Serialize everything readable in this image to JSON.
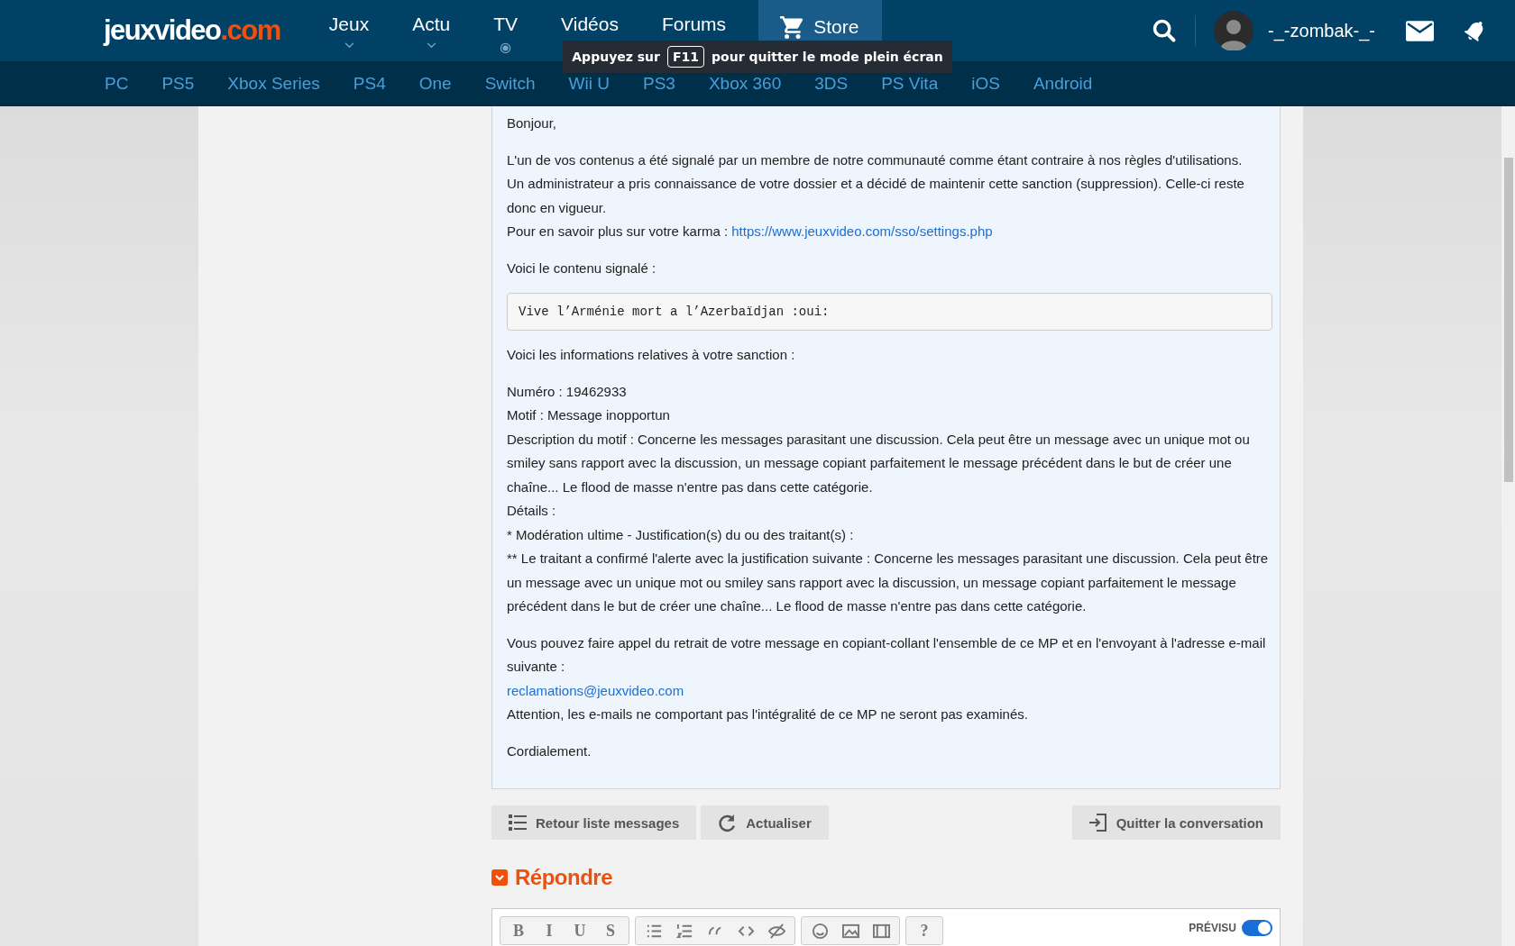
{
  "header": {
    "logo": {
      "main": "jeuxvideo",
      "accent": ".com"
    },
    "nav": [
      {
        "label": "Jeux",
        "selected": false
      },
      {
        "label": "Actu",
        "selected": false
      },
      {
        "label": "TV",
        "selected": false
      },
      {
        "label": "Vidéos",
        "selected": false
      },
      {
        "label": "Forums",
        "selected": false
      },
      {
        "label": "Store",
        "selected": true
      }
    ],
    "user": {
      "name": "-_-zombak-_-"
    }
  },
  "subnav": [
    "PC",
    "PS5",
    "Xbox Series",
    "PS4",
    "One",
    "Switch",
    "Wii U",
    "PS3",
    "Xbox 360",
    "3DS",
    "PS Vita",
    "iOS",
    "Android"
  ],
  "fullscreen_notice": {
    "before": "Appuyez sur",
    "key": "F11",
    "after": "pour quitter le mode plein écran"
  },
  "message": {
    "blocks": [
      {
        "kind": "para",
        "lines": [
          {
            "text": "Bonjour,"
          }
        ]
      },
      {
        "kind": "para",
        "lines": [
          {
            "text": "L'un de vos contenus a été signalé par un membre de notre communauté comme étant contraire à nos règles d'utilisations."
          },
          {
            "text": "Un administrateur a pris connaissance de votre dossier et a décidé de maintenir cette sanction (suppression). Celle-ci reste donc en vigueur."
          },
          {
            "text": "Pour en savoir plus sur votre karma : ",
            "link": "https://www.jeuxvideo.com/sso/settings.php"
          }
        ]
      },
      {
        "kind": "para",
        "lines": [
          {
            "text": "Voici le contenu signalé :"
          }
        ]
      },
      {
        "kind": "code",
        "text": "Vive l’Arménie mort a l’Azerbaïdjan :oui:"
      },
      {
        "kind": "para",
        "lines": [
          {
            "text": "Voici les informations relatives à votre sanction :"
          }
        ]
      },
      {
        "kind": "para",
        "lines": [
          {
            "text": "Numéro : 19462933"
          },
          {
            "text": "Motif : Message inopportun"
          },
          {
            "text": "Description du motif : Concerne les messages parasitant une discussion. Cela peut être un message avec un unique mot ou smiley sans rapport avec la discussion, un message copiant parfaitement le message précédent dans le but de créer une chaîne... Le flood de masse n'entre pas dans cette catégorie."
          },
          {
            "text": "Détails :"
          },
          {
            "text": "* Modération ultime - Justification(s) du ou des traitant(s) :"
          },
          {
            "text": "** Le traitant a confirmé l'alerte avec la justification suivante : Concerne les messages parasitant une discussion. Cela peut être un message avec un unique mot ou smiley sans rapport avec la discussion, un message copiant parfaitement le message précédent dans le but de créer une chaîne... Le flood de masse n'entre pas dans cette catégorie."
          }
        ]
      },
      {
        "kind": "para",
        "lines": [
          {
            "text": "Vous pouvez faire appel du retrait de votre message en copiant-collant l'ensemble de ce MP et en l'envoyant à l'adresse e-mail suivante :"
          },
          {
            "link": "reclamations@jeuxvideo.com"
          },
          {
            "text": "Attention, les e-mails ne comportant pas l'intégralité de ce MP ne seront pas examinés."
          }
        ]
      },
      {
        "kind": "para",
        "lines": [
          {
            "text": "Cordialement."
          }
        ]
      }
    ]
  },
  "actions": [
    {
      "label": "Retour liste messages"
    },
    {
      "label": "Actualiser"
    },
    {
      "label": "Quitter la conversation"
    }
  ],
  "reply": {
    "title": "Répondre",
    "toolbar": [
      [
        {
          "kind": "char",
          "label": "B"
        },
        {
          "kind": "char",
          "label": "I"
        },
        {
          "kind": "char",
          "label": "U"
        },
        {
          "kind": "char",
          "label": "S"
        }
      ],
      [
        {
          "kind": "bullets"
        },
        {
          "kind": "numbers"
        },
        {
          "kind": "quote"
        },
        {
          "kind": "code"
        },
        {
          "kind": "spoiler"
        }
      ],
      [
        {
          "kind": "smiley"
        },
        {
          "kind": "image"
        },
        {
          "kind": "video"
        }
      ],
      [
        {
          "kind": "char",
          "label": "?"
        }
      ]
    ],
    "preview": {
      "label": "PRÉVISU",
      "on": true
    }
  }
}
